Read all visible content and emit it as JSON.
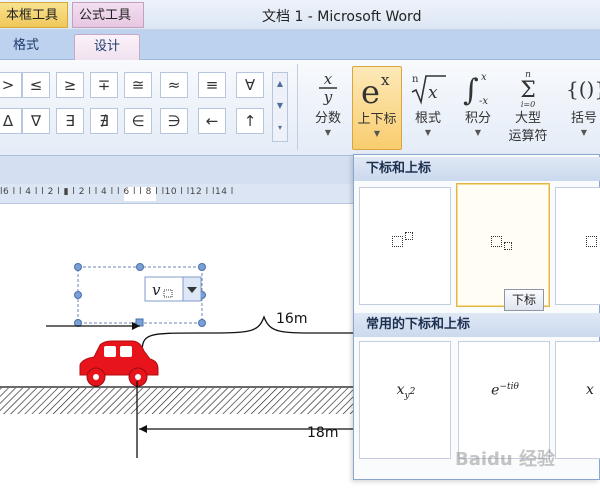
{
  "titlebar": {
    "context_tab_textbox": "本框工具",
    "context_tab_equation": "公式工具",
    "window_title": "文档 1 - Microsoft Word"
  },
  "tabs": {
    "format": "格式",
    "design": "设计"
  },
  "symbols": {
    "row1": [
      ">",
      "≤",
      "≥",
      "∓",
      "≅",
      "≈",
      "≡",
      "∀"
    ],
    "row2": [
      "Δ",
      "∇",
      "∃",
      "∄",
      "∈",
      "∋",
      "←",
      "↑"
    ]
  },
  "structures": [
    {
      "label": "分数",
      "icon": "fraction-icon"
    },
    {
      "label": "上下标",
      "icon": "script-icon"
    },
    {
      "label": "根式",
      "icon": "radical-icon"
    },
    {
      "label": "积分",
      "icon": "integral-icon"
    },
    {
      "label": "大型",
      "label2": "运算符",
      "icon": "large-operator-icon"
    },
    {
      "label": "括号",
      "icon": "bracket-icon"
    }
  ],
  "ruler": {
    "marks": "l6 l l 4 l l 2 l ▮ l 2 l l 4 l l 6 l l 8 l l10 l l12 l l14 l"
  },
  "document": {
    "var_label": "v",
    "dist_top": "16m",
    "dist_bottom": "18m",
    "car_color": "#e8141b"
  },
  "gallery": {
    "section1_title": "下标和上标",
    "section2_title": "常用的下标和上标",
    "tooltip": "下标",
    "examples": [
      "x",
      "y",
      "2",
      "e",
      "−tiθ"
    ]
  },
  "watermark": "Baidu 经验"
}
